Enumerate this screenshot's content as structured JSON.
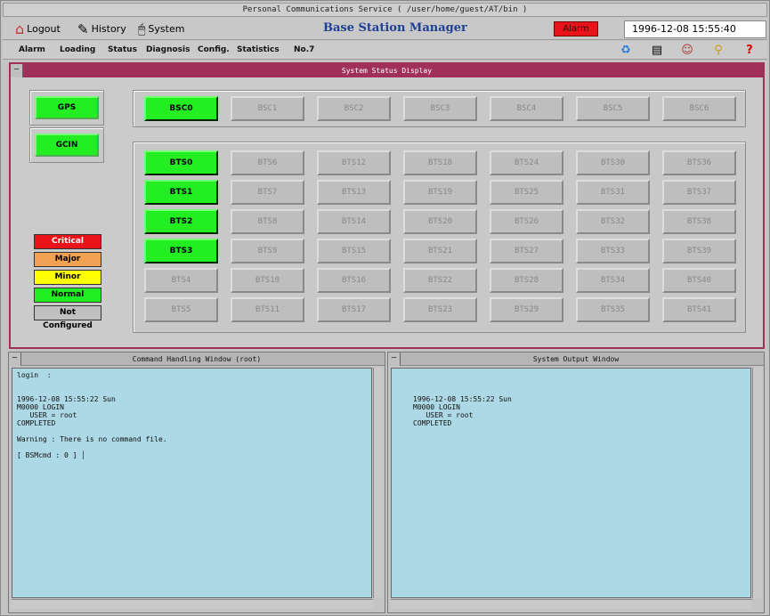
{
  "window_title": "Personal Communications Service ( /user/home/guest/AT/bin )",
  "toolbar": {
    "logout": "Logout",
    "history": "History",
    "system": "System",
    "app_title": "Base Station Manager",
    "alarm": "Alarm",
    "clock": "1996-12-08 15:55:40"
  },
  "menu": [
    "Alarm",
    "Loading",
    "Status",
    "Diagnosis",
    "Config.",
    "Statistics",
    "No.7"
  ],
  "menu_icons": [
    "recycle-icon",
    "window-icon",
    "people-icon",
    "search-icon",
    "help-icon"
  ],
  "status_display": {
    "title": "System Status Display",
    "side": [
      "GPS",
      "GCIN"
    ],
    "bsc": [
      {
        "label": "BSC0",
        "on": true
      },
      {
        "label": "BSC1",
        "on": false
      },
      {
        "label": "BSC2",
        "on": false
      },
      {
        "label": "BSC3",
        "on": false
      },
      {
        "label": "BSC4",
        "on": false
      },
      {
        "label": "BSC5",
        "on": false
      },
      {
        "label": "BSC6",
        "on": false
      }
    ],
    "bts_columns": [
      [
        "BTS0",
        "BTS1",
        "BTS2",
        "BTS3",
        "BTS4",
        "BTS5"
      ],
      [
        "BTS6",
        "BTS7",
        "BTS8",
        "BTS9",
        "BTS10",
        "BTS11"
      ],
      [
        "BTS12",
        "BTS13",
        "BTS14",
        "BTS15",
        "BTS16",
        "BTS17"
      ],
      [
        "BTS18",
        "BTS19",
        "BTS20",
        "BTS21",
        "BTS22",
        "BTS23"
      ],
      [
        "BTS24",
        "BTS25",
        "BTS26",
        "BTS27",
        "BTS28",
        "BTS29"
      ],
      [
        "BTS30",
        "BTS31",
        "BTS32",
        "BTS33",
        "BTS34",
        "BTS35"
      ],
      [
        "BTS36",
        "BTS37",
        "BTS38",
        "BTS39",
        "BTS40",
        "BTS41"
      ]
    ],
    "bts_on": [
      "BTS0",
      "BTS1",
      "BTS2",
      "BTS3"
    ],
    "legend": [
      {
        "label": "Critical",
        "color": "#e8141a",
        "text": "#ffffff"
      },
      {
        "label": "Major",
        "color": "#f3a253",
        "text": "#000000"
      },
      {
        "label": "Minor",
        "color": "#ffff00",
        "text": "#000000"
      },
      {
        "label": "Normal",
        "color": "#22ee22",
        "text": "#000000"
      },
      {
        "label": "Not Configured",
        "color": "#c0c0c0",
        "text": "#000000"
      }
    ]
  },
  "command_window": {
    "title": "Command Handling Window (root)",
    "text": "login  :\n\n\n1996-12-08 15:55:22 Sun\nM0000 LOGIN\n   USER = root\nCOMPLETED\n\nWarning : There is no command file.\n\n[ BSMcmd : 0 ] "
  },
  "output_window": {
    "title": "System Output Window",
    "text": "\n\n\n1996-12-08 15:55:22 Sun\nM0000 LOGIN\n   USER = root\nCOMPLETED"
  }
}
